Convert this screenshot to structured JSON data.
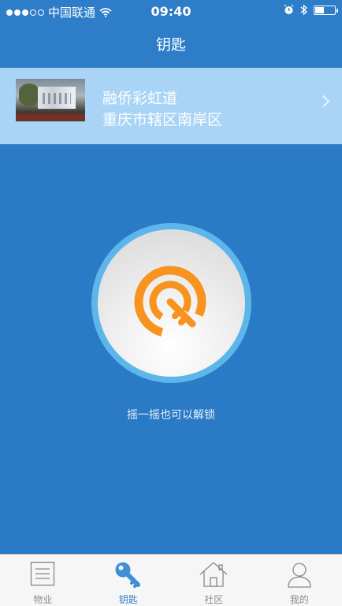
{
  "status_bar": {
    "carrier": "中国联通",
    "time": "09:40",
    "battery_level": 0.45
  },
  "nav": {
    "title": "钥匙"
  },
  "community": {
    "name": "融侨彩虹道",
    "address": "重庆市辖区南岸区"
  },
  "unlock": {
    "hint": "摇一摇也可以解锁",
    "key_color": "#f7931e"
  },
  "tabs": [
    {
      "label": "物业",
      "icon": "document-icon",
      "active": false
    },
    {
      "label": "钥匙",
      "icon": "key-icon",
      "active": true
    },
    {
      "label": "社区",
      "icon": "house-icon",
      "active": false
    },
    {
      "label": "我的",
      "icon": "person-icon",
      "active": false
    }
  ],
  "colors": {
    "primary": "#2d7dc9",
    "card": "#a9d4f5",
    "accent": "#f7931e"
  }
}
